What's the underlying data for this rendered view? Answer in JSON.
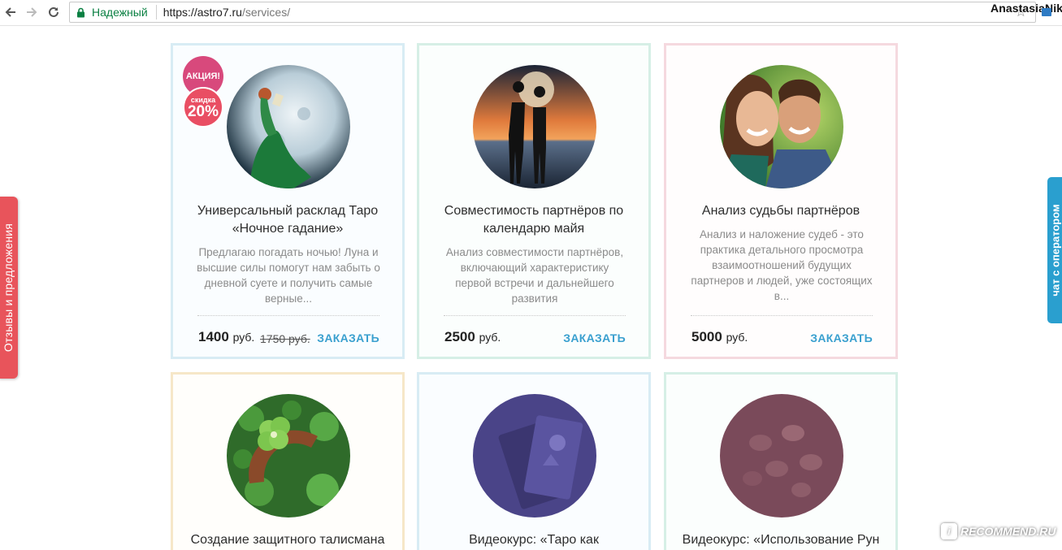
{
  "browser": {
    "secure_label": "Надежный",
    "url_host": "https://astro7.ru",
    "url_path": "/services/",
    "profile_name": "AnastasiaNik"
  },
  "side_tabs": {
    "left_label": "Отзывы и предложения",
    "right_label": "чат с оператором"
  },
  "cards": [
    {
      "title": "Универсальный расклад Таро «Ночное гадание»",
      "description": "Предлагаю погадать ночью! Луна и высшие силы помогут нам забыть о дневной суете и получить самые верные...",
      "price": "1400",
      "currency": "руб.",
      "old_price": "1750 руб.",
      "order_label": "ЗАКАЗАТЬ",
      "badge_sale": "АКЦИЯ!",
      "badge_discount_word": "скидка",
      "badge_discount_value": "20%"
    },
    {
      "title": "Совместимость партнёров по календарю майя",
      "description": "Анализ совместимости партнёров, включающий характеристику первой встречи и дальнейшего развития",
      "price": "2500",
      "currency": "руб.",
      "order_label": "ЗАКАЗАТЬ"
    },
    {
      "title": "Анализ судьбы партнёров",
      "description": "Анализ и наложение судеб - это практика детального просмотра взаимоотношений будущих партнеров и людей, уже состоящих в...",
      "price": "5000",
      "currency": "руб.",
      "order_label": "ЗАКАЗАТЬ"
    },
    {
      "title": "Создание защитного талисмана"
    },
    {
      "title": "Видеокурс: «Таро как"
    },
    {
      "title": "Видеокурс: «Использование Рун"
    }
  ],
  "watermark": "RECOMMEND.RU"
}
